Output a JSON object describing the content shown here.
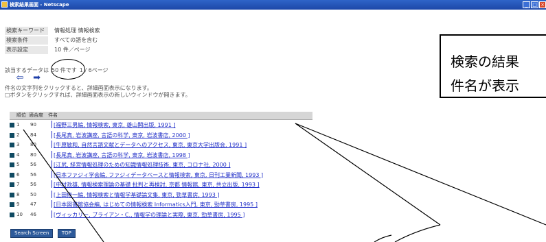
{
  "window": {
    "title": "検索結果画面 - Netscape",
    "buttons": [
      "_",
      "□",
      "×"
    ]
  },
  "params": [
    {
      "label": "検索キーワード",
      "value": "情報処理 情報検索"
    },
    {
      "label": "検索条件",
      "value": "すべての語を含む"
    },
    {
      "label": "表示設定",
      "value": "10 件／ページ"
    }
  ],
  "callout": {
    "line1": "検索の結果",
    "line2": "件名が表示"
  },
  "hits": {
    "prefix": "該当するデータは",
    "count": "50 件です",
    "page": "1 / 6ページ"
  },
  "nav": {
    "prev": "⇦",
    "next": "➡"
  },
  "instructions": [
    "件名の文字列をクリックすると、詳細画面表示になります。",
    "□ボタンをクリックすれば、詳細画面表示の新しいウィンドウが開きます。"
  ],
  "table": {
    "headers": [
      "順位",
      "適合度",
      "件名"
    ],
    "rows": [
      {
        "rank": "1",
        "score": "90",
        "title": "[福野三男編, 情報検索, 東京, 雄山閣出版, 1991 ]"
      },
      {
        "rank": "2",
        "score": "84",
        "title": "[長尾真, 岩波講座, 言語の科学, 東京, 岩波書店, 2000 ]"
      },
      {
        "rank": "3",
        "score": "80",
        "title": "[牛原敏和, 自然言語文献とデータへのアクセス, 東京, 東京大学出版会, 1991 ]"
      },
      {
        "rank": "4",
        "score": "80",
        "title": "[長尾真, 岩波講座, 言語の科学, 東京, 岩波書店, 1998 ]"
      },
      {
        "rank": "5",
        "score": "56",
        "title": "[江尻, 経営情報処理のための知識情報処理技術, 東京, コロナ社, 2000 ]"
      },
      {
        "rank": "6",
        "score": "56",
        "title": "[日本ファジィ学会編, ファジィデータベースと情報検索, 東京, 日刊工業新聞, 1993 ]"
      },
      {
        "rank": "7",
        "score": "56",
        "title": "[中村政雄, 情報検索理論の基礎 批判と再検討, 京都 情報館, 東京, 共立出版, 1993 ]"
      },
      {
        "rank": "8",
        "score": "50",
        "title": "[上田修一編, 情報検索と情報学基礎論文集, 東京, 勁草書房, 1993 ]"
      },
      {
        "rank": "9",
        "score": "47",
        "title": "[日本図書館協会編, はじめての情報検索 Informatics入門, 東京, 勁草書房, 1995 ]"
      },
      {
        "rank": "10",
        "score": "46",
        "title": "[ヴィッカリー, ブライアン・C., 情報学の理論と実際, 東京, 勁草書房, 1995 ]"
      }
    ]
  },
  "buttons": [
    "Search Screen",
    "TOP"
  ]
}
